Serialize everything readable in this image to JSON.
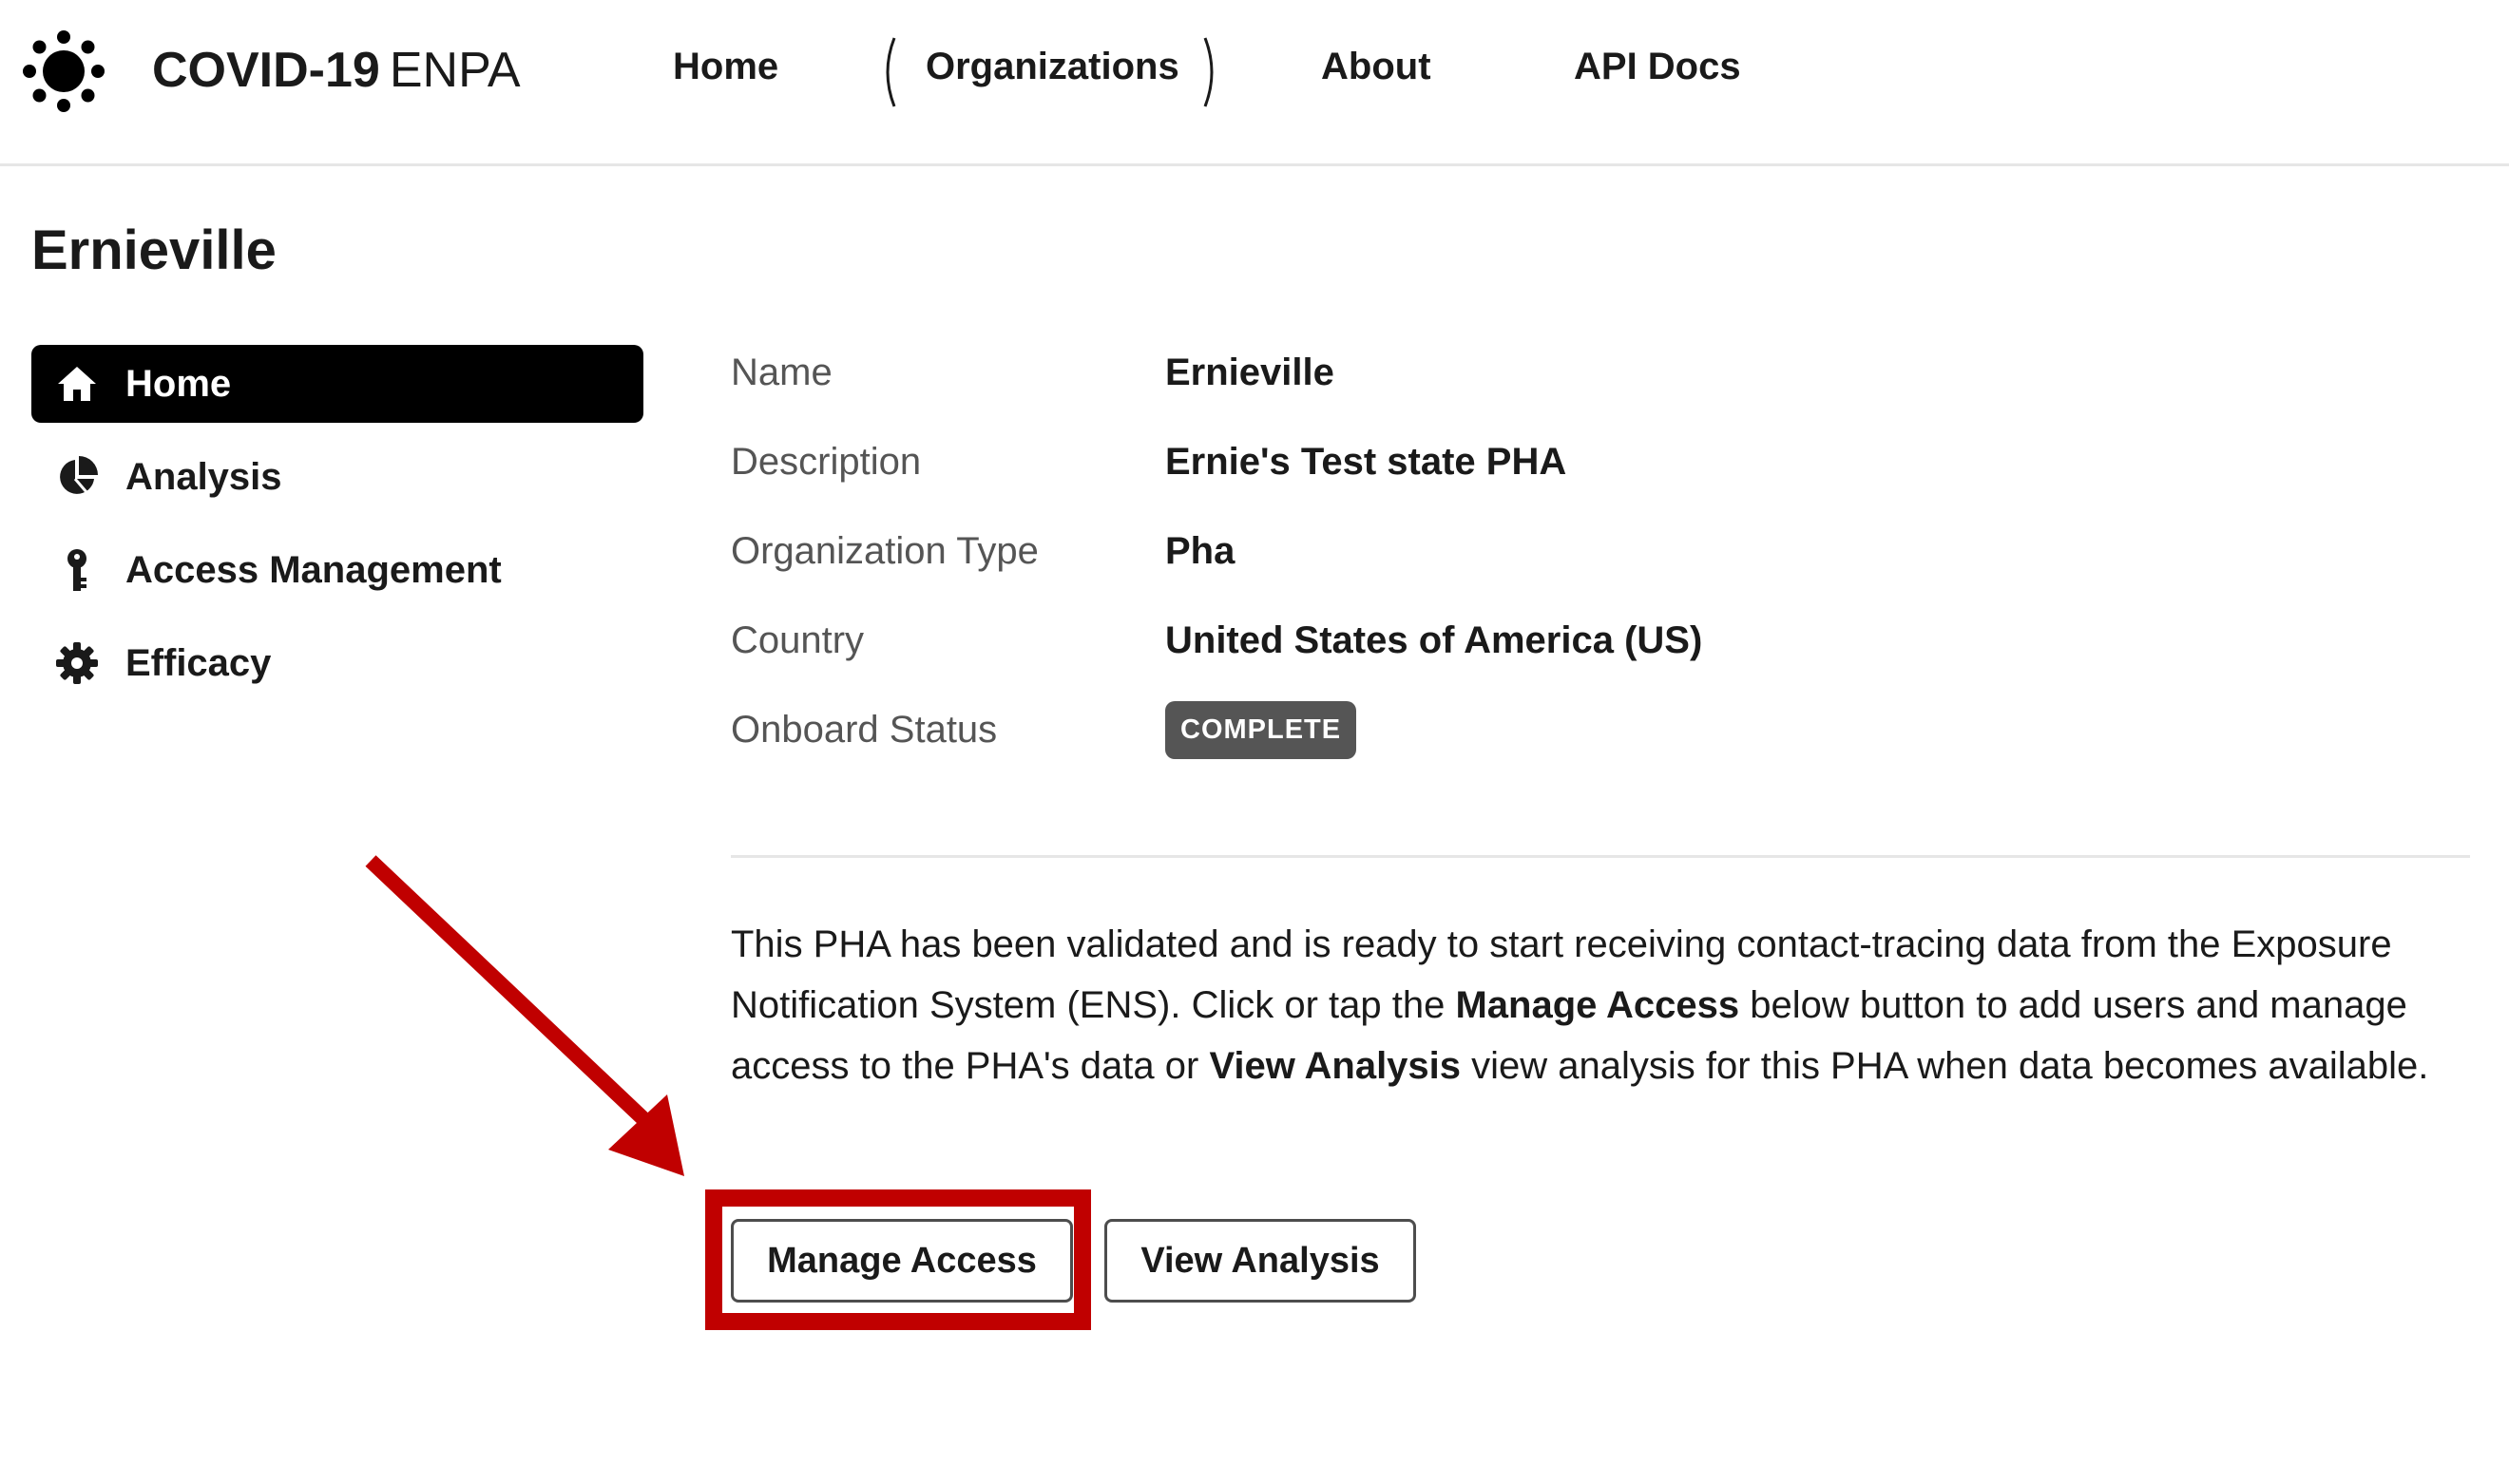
{
  "header": {
    "brand_bold": "COVID-19",
    "brand_thin": "ENPA",
    "nav": {
      "home": "Home",
      "organizations": "Organizations",
      "about": "About",
      "api_docs": "API Docs"
    }
  },
  "page": {
    "title": "Ernieville"
  },
  "sidebar": {
    "items": [
      {
        "label": "Home",
        "icon": "home-icon",
        "active": true
      },
      {
        "label": "Analysis",
        "icon": "pie-chart-icon",
        "active": false
      },
      {
        "label": "Access Management",
        "icon": "key-icon",
        "active": false
      },
      {
        "label": "Efficacy",
        "icon": "gear-icon",
        "active": false
      }
    ]
  },
  "details": {
    "name": {
      "label": "Name",
      "value": "Ernieville"
    },
    "description": {
      "label": "Description",
      "value": "Ernie's Test state PHA"
    },
    "org_type": {
      "label": "Organization Type",
      "value": "Pha"
    },
    "country": {
      "label": "Country",
      "value": "United States of America (US)"
    },
    "onboard_status": {
      "label": "Onboard Status",
      "value": "COMPLETE"
    }
  },
  "description_text": {
    "part1": "This PHA has been validated and is ready to start receiving contact-tracing data from the Exposure Notification System (ENS). Click or tap the ",
    "bold1": "Manage Access",
    "part2": " below button to add users and manage access to the PHA's data or ",
    "bold2": "View Analysis",
    "part3": " view analysis for this PHA when data becomes available."
  },
  "buttons": {
    "manage_access": "Manage Access",
    "view_analysis": "View Analysis"
  },
  "colors": {
    "highlight": "#c00000",
    "badge": "#555555",
    "active_sidebar": "#000000"
  }
}
